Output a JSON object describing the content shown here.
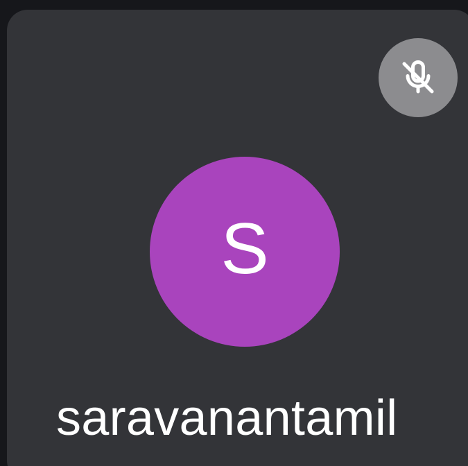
{
  "participant": {
    "initial": "S",
    "name": "saravanantamil",
    "avatar_color": "#a944bd",
    "muted": true,
    "mute_icon": "microphone-off-icon"
  },
  "colors": {
    "background": "#16171b",
    "tile": "#333438",
    "mute_badge": "#8c8c8f",
    "text": "#ffffff"
  }
}
